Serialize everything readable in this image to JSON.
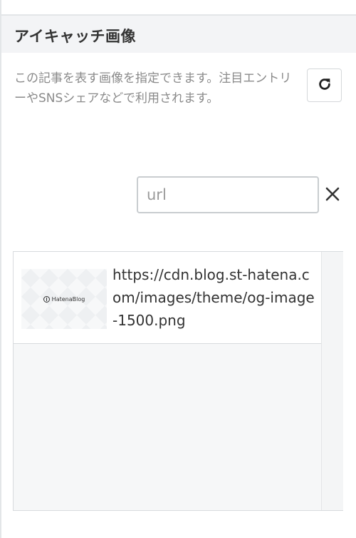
{
  "section": {
    "title": "アイキャッチ画像"
  },
  "description": "この記事を表す画像を指定できます。注目エントリーやSNSシェアなどで利用されます。",
  "refresh": {
    "icon": "refresh-icon"
  },
  "url_input": {
    "placeholder": "url",
    "value": ""
  },
  "clear": {
    "icon": "close-icon"
  },
  "images": {
    "items": [
      {
        "thumbnail_logo_text": "HatenaBlog",
        "url": "https://cdn.blog.st-hatena.com/images/theme/og-image-1500.png"
      }
    ]
  }
}
